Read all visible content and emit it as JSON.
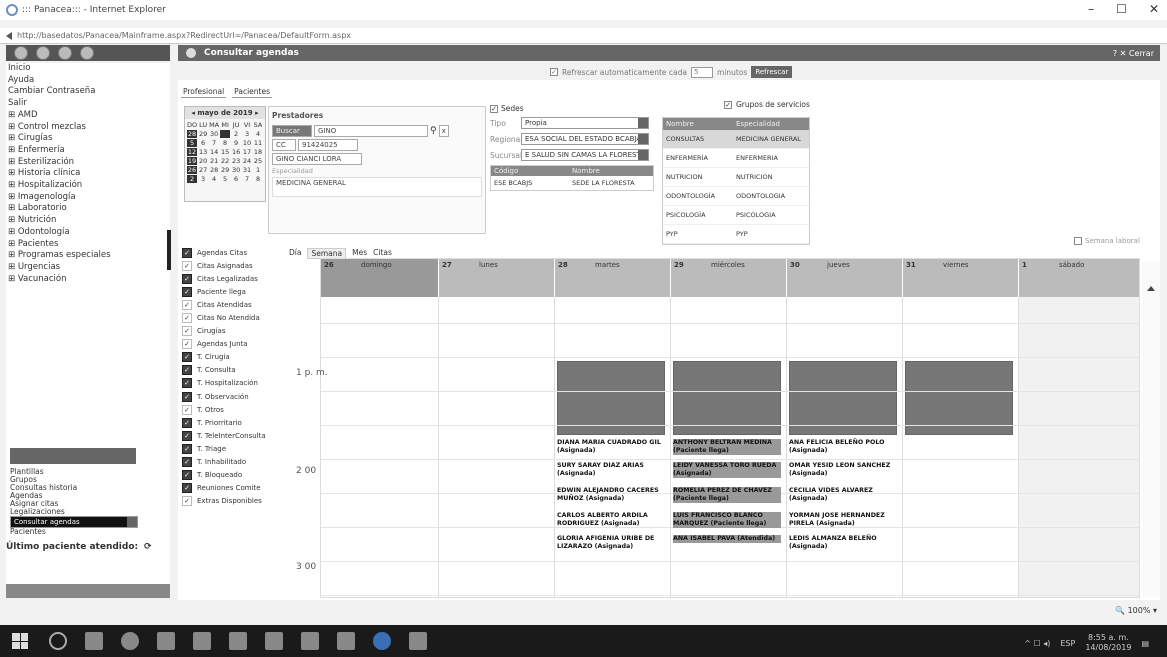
{
  "window": {
    "title": "::: Panacea::: - Internet Explorer",
    "url": "http://basedatos/Panacea/Mainframe.aspx?RedirectUrl=/Panacea/DefaultForm.aspx",
    "controls": [
      "–",
      "☐",
      "✕"
    ]
  },
  "sidebar": {
    "items": [
      "Inicio",
      "Ayuda",
      "Cambiar Contraseña",
      "Salir",
      "⊞ AMD",
      "⊞ Control mezclas",
      "⊞ Cirugías",
      "⊞ Enfermería",
      "⊞ Esterilización",
      "⊞ Historia clínica",
      "⊞ Hospitalización",
      "⊞ Imagenología",
      "⊞ Laboratorio",
      "⊞ Nutrición",
      "⊞ Odontología",
      "⊞ Pacientes",
      "⊞ Programas especiales",
      "⊞ Urgencias",
      "⊞ Vacunación"
    ],
    "sub_items": [
      "Plantillas",
      "Grupos",
      "Consultas historia",
      "Agendas",
      "Asignar citas",
      "Legalizaciones",
      "Consultar agendas",
      "Pacientes"
    ],
    "selected_sub": "Consultar agendas",
    "last_patient": "Último paciente atendido:"
  },
  "header": {
    "title": "Consultar agendas",
    "close_label": "Cerrar"
  },
  "refresh": {
    "label": "Refrescar automaticamente cada",
    "minutes": "5",
    "unit": "minutos",
    "button": "Refrescar"
  },
  "tabs": [
    "Profesional",
    "Pacientes"
  ],
  "calendar": {
    "month": "mayo de 2019",
    "days_header": [
      "DO",
      "LU",
      "MA",
      "MI",
      "JU",
      "VI",
      "SA"
    ],
    "rows": [
      [
        "28",
        "29",
        "30",
        "",
        "2",
        "3",
        "4"
      ],
      [
        "5",
        "6",
        "7",
        "8",
        "9",
        "10",
        "11"
      ],
      [
        "12",
        "13",
        "14",
        "15",
        "16",
        "17",
        "18"
      ],
      [
        "19",
        "20",
        "21",
        "22",
        "23",
        "24",
        "25"
      ],
      [
        "26",
        "27",
        "28",
        "29",
        "30",
        "31",
        "1"
      ],
      [
        "2",
        "3",
        "4",
        "5",
        "6",
        "7",
        "8"
      ]
    ]
  },
  "prestadores": {
    "title": "Prestadores",
    "search_label": "Buscar",
    "search_value": "GINO",
    "doc_type": "CC",
    "doc_number": "91424025",
    "name": "GINO CIANCI LORA",
    "esp_label": "Especialidad",
    "especialidad": "MEDICINA GENERAL"
  },
  "sedes": {
    "title": "Sedes",
    "tipo_label": "Tipo",
    "tipo": "Propia",
    "regional_label": "Regional",
    "regional": "ESA SOCIAL DEL ESTADO BCABJA",
    "sucursal_label": "Sucursal",
    "sucursal": "E SALUD SIN CAMAS LA FLORESTA",
    "cols": [
      "Código",
      "Nombre"
    ],
    "rows": [
      [
        "ESE BCABJS",
        "SEDE LA FLORESTA"
      ]
    ]
  },
  "grupos": {
    "title": "Grupos de servicios",
    "cols": [
      "Nombre",
      "Especialidad"
    ],
    "rows": [
      [
        "CONSULTAS",
        "MEDICINA GENERAL"
      ],
      [
        "ENFERMERÍA",
        "ENFERMERIA"
      ],
      [
        "NUTRICION",
        "NUTRICION"
      ],
      [
        "ODONTOLOGÍA",
        "ODONTOLOGIA"
      ],
      [
        "PSICOLOGÍA",
        "PSICOLOGIA"
      ],
      [
        "PYP",
        "PYP"
      ]
    ]
  },
  "legend": [
    [
      "Agendas Citas",
      0
    ],
    [
      "Citas Asignadas",
      1
    ],
    [
      "Citas Legalizadas",
      0
    ],
    [
      "Paciente llega",
      0
    ],
    [
      "Citas Atendidas",
      1
    ],
    [
      "Citas No Atendida",
      1
    ],
    [
      "Cirugías",
      1
    ],
    [
      "Agendas Junta",
      1
    ],
    [
      "T. Cirugía",
      0
    ],
    [
      "T. Consulta",
      0
    ],
    [
      "T. Hospitalización",
      0
    ],
    [
      "T. Observación",
      0
    ],
    [
      "T. Otros",
      1
    ],
    [
      "T. Priorritario",
      0
    ],
    [
      "T. TeleInterConsulta",
      0
    ],
    [
      "T. Triage",
      0
    ],
    [
      "T. Inhabilitado",
      0
    ],
    [
      "T. Bloqueado",
      0
    ],
    [
      "Reuniones Comite",
      0
    ],
    [
      "Extras Disponibles",
      1
    ]
  ],
  "view_tabs": [
    "Día",
    "Semana",
    "Mes",
    "Citas"
  ],
  "semana_laboral": "Semana laboral",
  "week": {
    "days": [
      [
        "26",
        "domingo"
      ],
      [
        "27",
        "lunes"
      ],
      [
        "28",
        "martes"
      ],
      [
        "29",
        "miércoles"
      ],
      [
        "30",
        "jueves"
      ],
      [
        "31",
        "viernes"
      ],
      [
        "1",
        "sábado"
      ]
    ],
    "times": [
      "1 p. m.",
      "2 00",
      "3 00"
    ],
    "appts": {
      "tue": [
        "DIANA MARIA CUADRADO GIL (Asignada)",
        "SURY SARAY DIAZ ARIAS (Asignada)",
        "EDWIN ALEJANDRO CACERES MUÑOZ (Asignada)",
        "CARLOS ALBERTO ARDILA RODRIGUEZ (Asignada)",
        "GLORIA AFIGENIA URIBE DE LIZARAZO (Asignada)"
      ],
      "wed": [
        "ANTHONY BELTRAN MEDINA (Paciente llega)",
        "LEIDY VANESSA TORO RUEDA (Asignada)",
        "ROMELIA PEREZ DE CHAVEZ (Paciente llega)",
        "LUIS FRANCISCO BLANCO MARQUEZ (Paciente llega)",
        "ANA ISABEL PAVA (Atendida)"
      ],
      "thu": [
        "ANA FELICIA BELEÑO POLO (Asignada)",
        "OMAR YESID LEON SANCHEZ (Asignada)",
        "CECILIA VIDES ALVAREZ (Asignada)",
        "YORMAN JOSE HERNANDEZ PIRELA (Asignada)",
        "LEDIS ALMANZA BELEÑO (Asignada)"
      ]
    }
  },
  "zoom": "100%",
  "tray": {
    "lang": "ESP",
    "time": "8:55 a. m.",
    "date": "14/08/2019"
  }
}
